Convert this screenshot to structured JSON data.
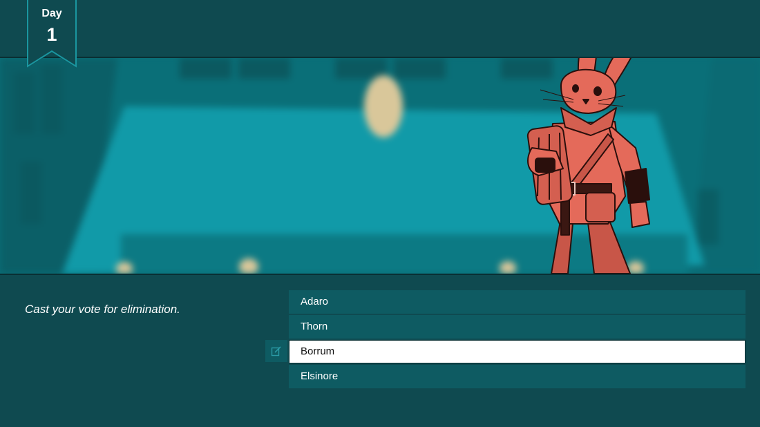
{
  "day": {
    "label": "Day",
    "number": "1"
  },
  "prompt": "Cast your vote for elimination.",
  "options": [
    {
      "label": "Adaro",
      "selected": false
    },
    {
      "label": "Thorn",
      "selected": false
    },
    {
      "label": "Borrum",
      "selected": true
    },
    {
      "label": "Elsinore",
      "selected": false
    }
  ],
  "icons": {
    "edit": "edit-note-icon"
  },
  "colors": {
    "panel": "#0f4a50",
    "scene": "#0a6f78",
    "option": "#0e5b62",
    "selected": "#ffffff",
    "character": "#e46a5a"
  }
}
